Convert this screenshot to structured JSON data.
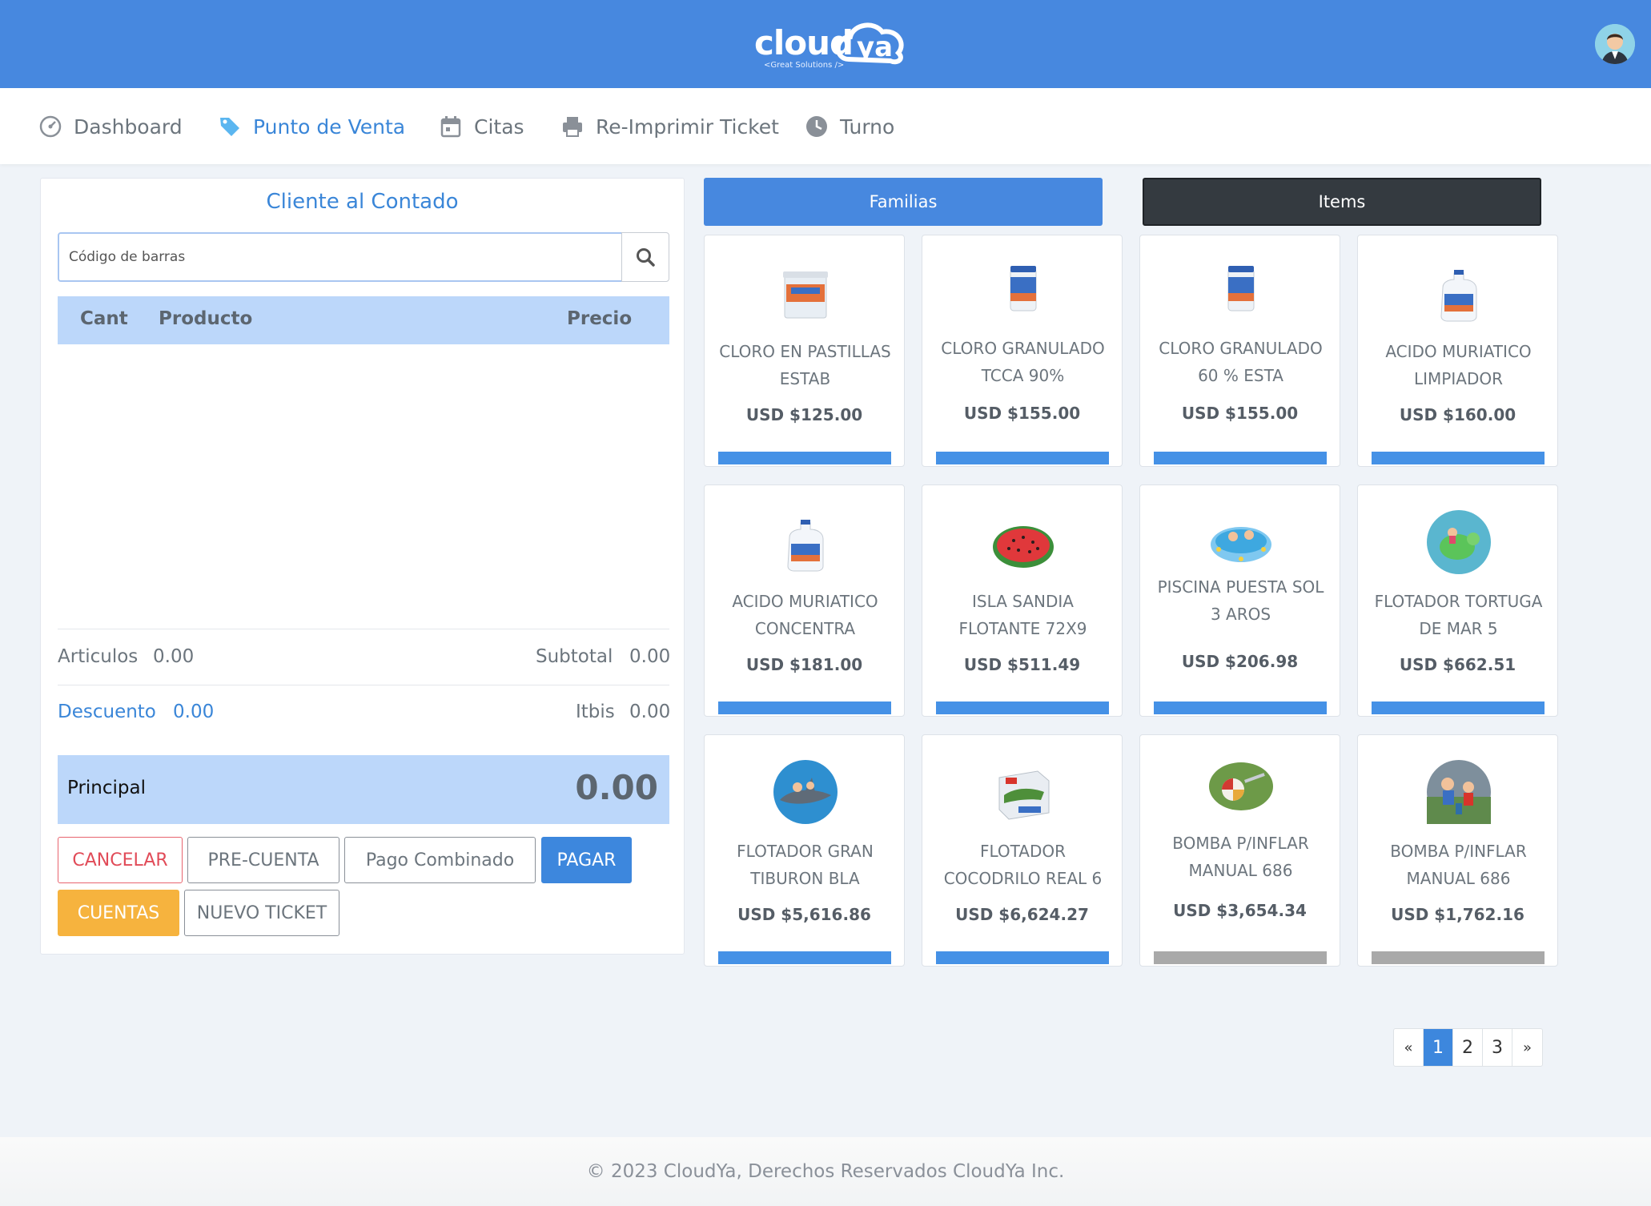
{
  "brand": {
    "logo_text": "cloud ya",
    "tagline": "<Great Solutions />"
  },
  "nav": [
    {
      "label": "Dashboard",
      "icon": "dashboard-icon"
    },
    {
      "label": "Punto de Venta",
      "icon": "tag-icon"
    },
    {
      "label": "Citas",
      "icon": "calendar-icon"
    },
    {
      "label": "Re-Imprimir Ticket",
      "icon": "printer-icon"
    },
    {
      "label": "Turno",
      "icon": "clock-icon"
    }
  ],
  "sale": {
    "client": "Cliente al Contado",
    "barcode_placeholder": "Código de barras",
    "columns": {
      "qty": "Cant",
      "product": "Producto",
      "price": "Precio"
    },
    "articles_label": "Articulos",
    "articles_value": "0.00",
    "subtotal_label": "Subtotal",
    "subtotal_value": "0.00",
    "discount_label": "Descuento",
    "discount_value": "0.00",
    "itbis_label": "Itbis",
    "itbis_value": "0.00",
    "total_label": "Principal",
    "total_value": "0.00",
    "buttons": {
      "cancel": "CANCELAR",
      "precuenta": "PRE-CUENTA",
      "combined": "Pago Combinado",
      "pay": "PAGAR",
      "accounts": "CUENTAS",
      "new_ticket": "NUEVO TICKET"
    }
  },
  "catalog": {
    "tab_families": "Familias",
    "tab_items": "Items",
    "products": [
      {
        "name_line1": "CLORO EN PASTILLAS",
        "name_line2": "ESTAB",
        "price": "USD $125.00",
        "bar": "blue"
      },
      {
        "name_line1": "CLORO GRANULADO",
        "name_line2": "TCCA 90%",
        "price": "USD $155.00",
        "bar": "blue"
      },
      {
        "name_line1": "CLORO GRANULADO",
        "name_line2": "60 % ESTA",
        "price": "USD $155.00",
        "bar": "blue"
      },
      {
        "name_line1": "ACIDO MURIATICO",
        "name_line2": "LIMPIADOR",
        "price": "USD $160.00",
        "bar": "blue"
      },
      {
        "name_line1": "ACIDO MURIATICO",
        "name_line2": "CONCENTRA",
        "price": "USD $181.00",
        "bar": "blue"
      },
      {
        "name_line1": "ISLA SANDIA",
        "name_line2": "FLOTANTE 72X9",
        "price": "USD $511.49",
        "bar": "blue"
      },
      {
        "name_line1": "PISCINA PUESTA SOL",
        "name_line2": "3 AROS",
        "price": "USD $206.98",
        "bar": "blue"
      },
      {
        "name_line1": "FLOTADOR TORTUGA",
        "name_line2": "DE MAR 5",
        "price": "USD $662.51",
        "bar": "blue"
      },
      {
        "name_line1": "FLOTADOR GRAN",
        "name_line2": "TIBURON BLA",
        "price": "USD $5,616.86",
        "bar": "blue"
      },
      {
        "name_line1": "FLOTADOR",
        "name_line2": "COCODRILO REAL 6",
        "price": "USD $6,624.27",
        "bar": "blue"
      },
      {
        "name_line1": "BOMBA P/INFLAR",
        "name_line2": "MANUAL 686",
        "price": "USD $3,654.34",
        "bar": "gray"
      },
      {
        "name_line1": "BOMBA P/INFLAR",
        "name_line2": "MANUAL 686",
        "price": "USD $1,762.16",
        "bar": "gray"
      }
    ],
    "pagination": {
      "prev": "«",
      "pages": [
        "1",
        "2",
        "3"
      ],
      "next": "»",
      "current": "1"
    }
  },
  "footer": "© 2023 CloudYa, Derechos Reservados CloudYa Inc.",
  "colors": {
    "header": "#4788df",
    "accent": "#3a86d8",
    "warning": "#f6b33e",
    "danger": "#e14b58",
    "dark": "#343a40"
  }
}
